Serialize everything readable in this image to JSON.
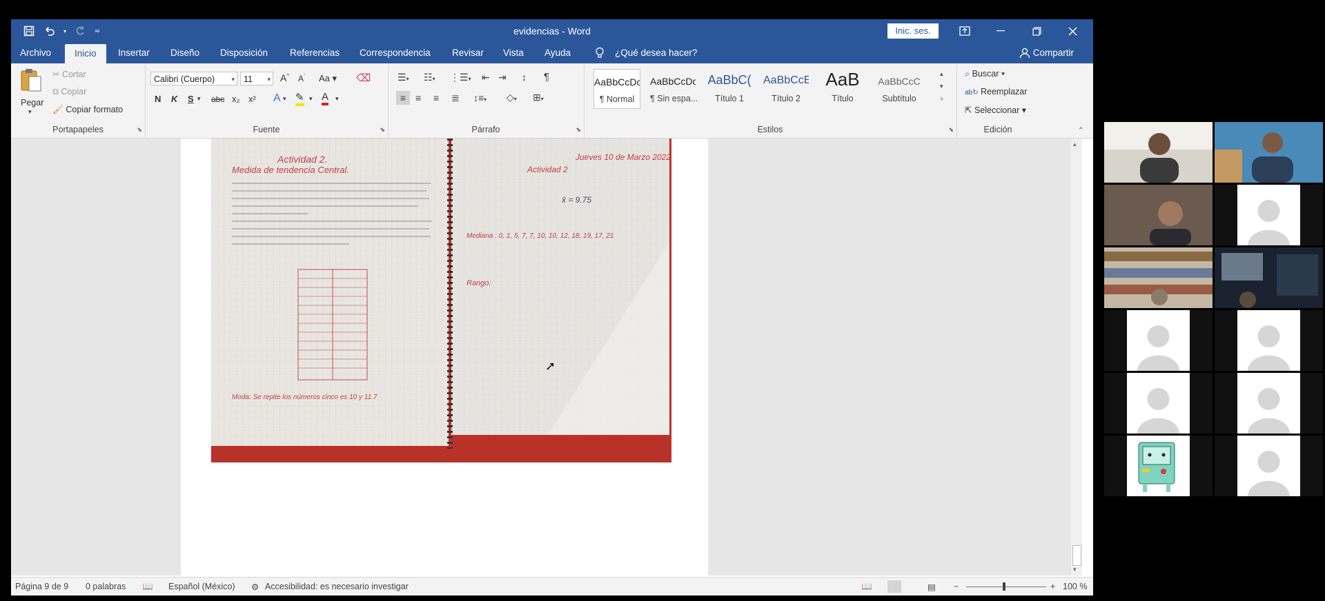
{
  "window": {
    "title": "evidencias - Word",
    "signin": "Inic. ses."
  },
  "qat": {
    "save_icon": "save-icon",
    "undo_icon": "undo-icon",
    "redo_icon": "redo-icon"
  },
  "tabs": [
    "Archivo",
    "Inicio",
    "Insertar",
    "Diseño",
    "Disposición",
    "Referencias",
    "Correspondencia",
    "Revisar",
    "Vista",
    "Ayuda",
    "¿Qué desea hacer?"
  ],
  "share": "Compartir",
  "ribbon": {
    "clipboard": {
      "label": "Portapapeles",
      "paste": "Pegar",
      "cut": "Cortar",
      "copy": "Copiar",
      "format_painter": "Copiar formato"
    },
    "font": {
      "label": "Fuente",
      "name": "Calibri (Cuerpo)",
      "size": "11",
      "bold": "N",
      "italic": "K",
      "underline": "S",
      "strike": "abc",
      "sub": "x₂",
      "sup": "x²",
      "case": "Aa"
    },
    "paragraph": {
      "label": "Párrafo"
    },
    "styles": {
      "label": "Estilos",
      "items": [
        {
          "preview": "AaBbCcDc",
          "name": "¶ Normal"
        },
        {
          "preview": "AaBbCcDc",
          "name": "¶ Sin espa..."
        },
        {
          "preview": "AaBbC(",
          "name": "Título 1"
        },
        {
          "preview": "AaBbCcE",
          "name": "Título 2"
        },
        {
          "preview": "AaB",
          "name": "Título"
        },
        {
          "preview": "AaBbCcC",
          "name": "Subtítulo"
        }
      ]
    },
    "editing": {
      "label": "Edición",
      "find": "Buscar",
      "replace": "Reemplazar",
      "select": "Seleccionar"
    }
  },
  "notebook": {
    "left_title": "Actividad 2.",
    "left_subtitle": "Medida de tendencia Central.",
    "right_date": "Jueves 10 de Marzo 2022",
    "right_title": "Actividad 2",
    "media": "x̄ = 9.75",
    "mediana": "Mediana : 0, 1, 5, 7, 7, 10, 10, 12, 18, 19, 17, 21",
    "rango": "Rango:",
    "moda": "Moda: Se repite los números cinco es 10 y 11.7"
  },
  "status": {
    "page": "Página 9 de 9",
    "words": "0 palabras",
    "language": "Español (México)",
    "accessibility": "Accesibilidad: es necesario investigar",
    "zoom": "100 %"
  },
  "colors": {
    "accent": "#2b579a",
    "ribbon_bg": "#f3f3f3",
    "doc_bg": "#e6e6e6"
  }
}
